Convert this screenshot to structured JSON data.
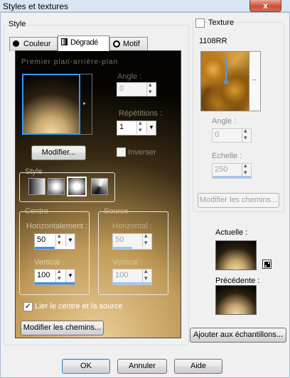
{
  "window": {
    "title": "Styles et textures",
    "close_label": "x"
  },
  "style_group": {
    "label": "Style"
  },
  "tabs": [
    {
      "label": "Couleur",
      "icon": "color-dot-icon"
    },
    {
      "label": "Dégradé",
      "icon": "gradient-icon"
    },
    {
      "label": "Motif",
      "icon": "pattern-icon"
    }
  ],
  "gradient": {
    "name_label": "Premier plan-arrière-plan",
    "angle_label": "Angle :",
    "angle_value": "0",
    "repetitions_label": "Répétitions :",
    "repetitions_value": "1",
    "modify_button": "Modifier...",
    "invert_label": "Inverser",
    "style_label": "Style",
    "center_label": "Centre",
    "center_h_label": "Horizontalement :",
    "center_h_value": "50",
    "center_h_fill": 0.5,
    "center_v_label": "Vertical :",
    "center_v_value": "100",
    "center_v_fill": 1.0,
    "source_label": "Source",
    "source_h_label": "Horizontal :",
    "source_h_value": "50",
    "source_h_fill": 0.5,
    "source_v_label": "Vertical :",
    "source_v_value": "100",
    "source_v_fill": 1.0,
    "link_label": "Lier le centre et la source",
    "link_checked": true,
    "modify_paths_button": "Modifier les chemins..."
  },
  "texture": {
    "label": "Texture",
    "checked": false,
    "name": "1108RR",
    "angle_label": "Angle :",
    "angle_value": "0",
    "scale_label": "Echelle :",
    "scale_value": "250",
    "scale_fill": 1.0,
    "modify_paths_button": "Modifier les chemins..."
  },
  "preview": {
    "current_label": "Actuelle :",
    "previous_label": "Précédente :",
    "add_button": "Ajouter aux échantillons..."
  },
  "footer": {
    "ok": "OK",
    "cancel": "Annuler",
    "help": "Aide"
  },
  "colors": {
    "accent": "#3b8fe5",
    "selection": "#3399ff"
  }
}
